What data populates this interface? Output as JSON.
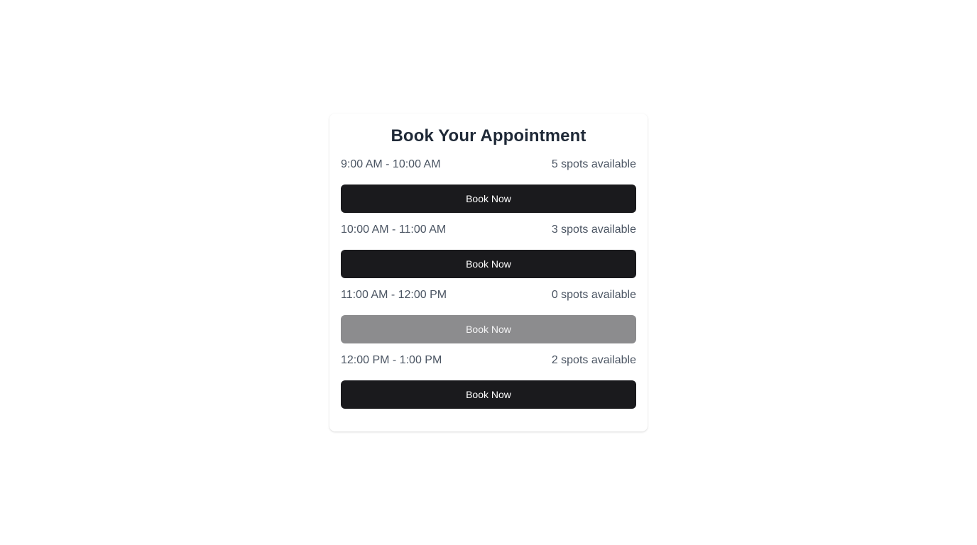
{
  "booking": {
    "title": "Book Your Appointment",
    "slots": [
      {
        "time": "9:00 AM - 10:00 AM",
        "spots": "5 spots available",
        "button_label": "Book Now",
        "disabled": false
      },
      {
        "time": "10:00 AM - 11:00 AM",
        "spots": "3 spots available",
        "button_label": "Book Now",
        "disabled": false
      },
      {
        "time": "11:00 AM - 12:00 PM",
        "spots": "0 spots available",
        "button_label": "Book Now",
        "disabled": true
      },
      {
        "time": "12:00 PM - 1:00 PM",
        "spots": "2 spots available",
        "button_label": "Book Now",
        "disabled": false
      }
    ]
  },
  "colors": {
    "button_active": "#1a1a1d",
    "button_disabled": "#8c8c8e",
    "title_text": "#1f2937",
    "secondary_text": "#4b5563"
  }
}
